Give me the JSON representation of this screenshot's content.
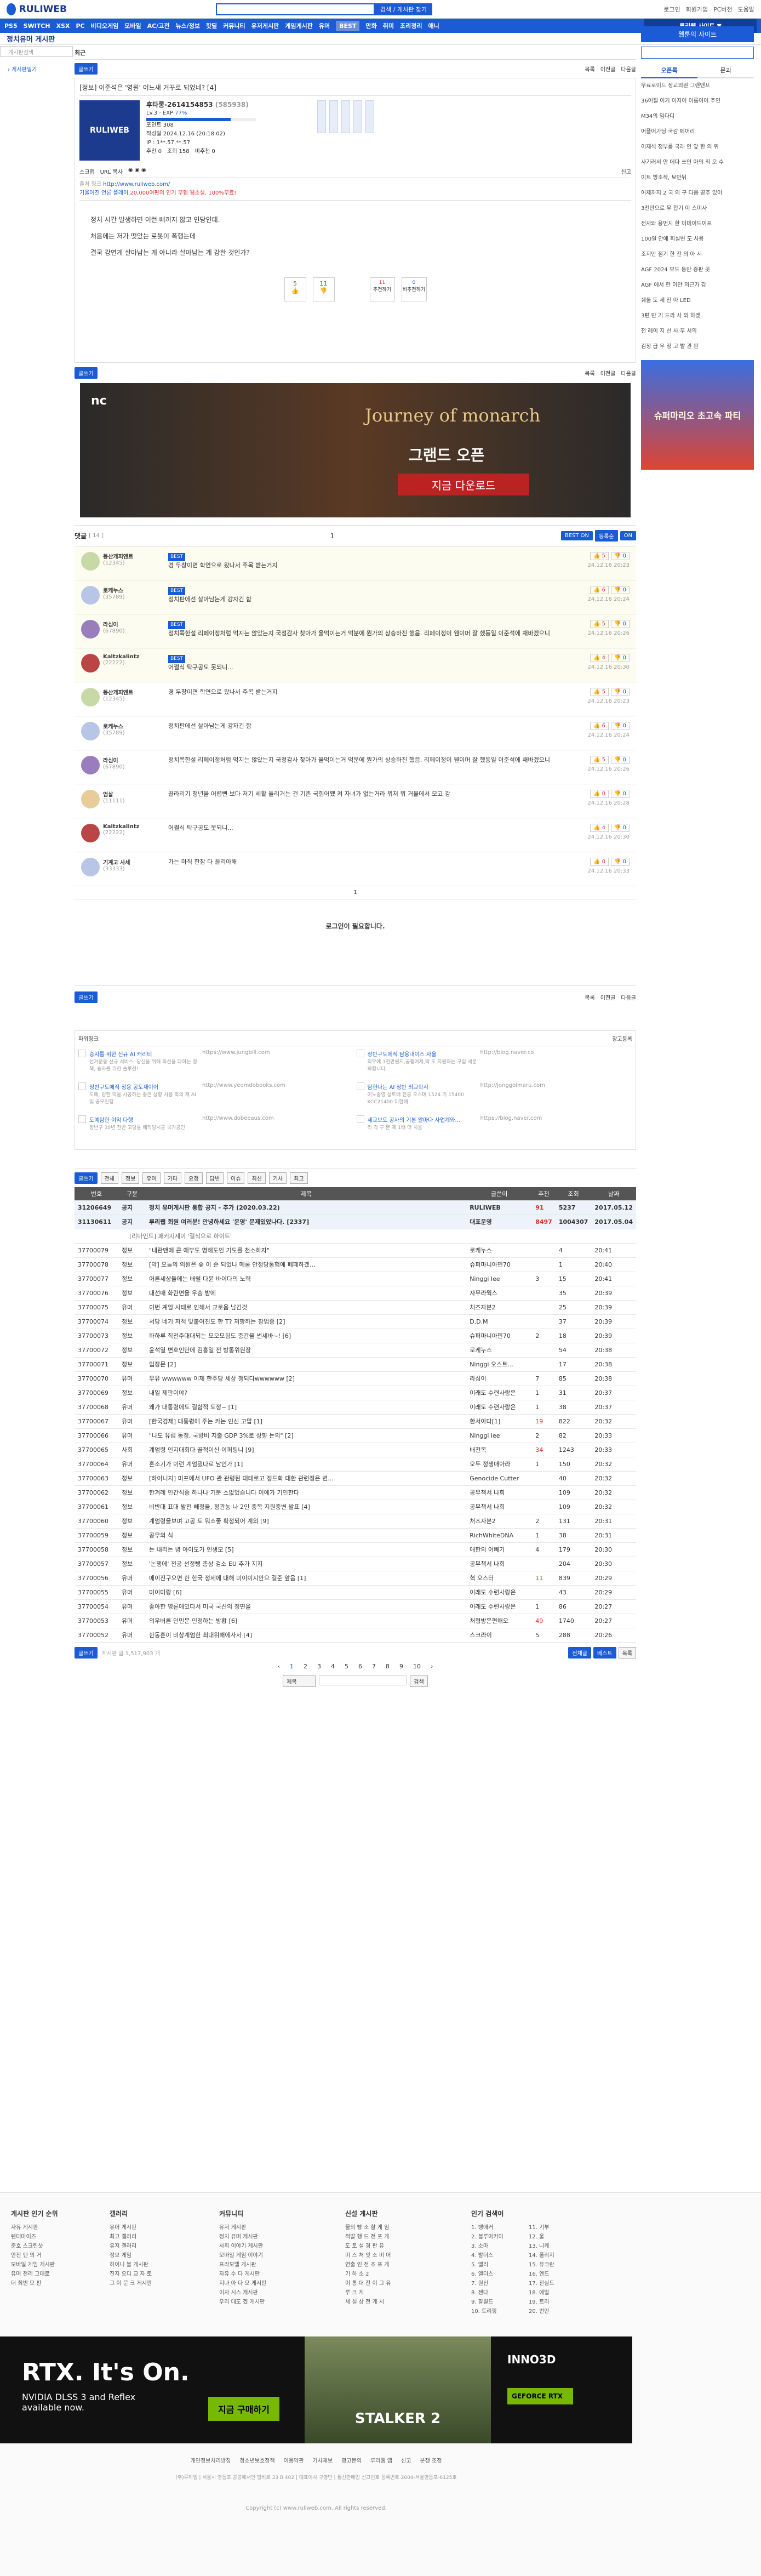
{
  "header": {
    "logo": "RULIWEB",
    "search_btn": "검색 / 게시판 찾기",
    "login": "로그인",
    "join": "회원가입",
    "links": [
      "PC버전",
      "도움말"
    ]
  },
  "nav": {
    "items": [
      "PS5",
      "SWITCH",
      "XSX",
      "PC",
      "비디오게임",
      "모바일",
      "AC/고전",
      "뉴스/정보",
      "핫딜",
      "커뮤니티",
      "유저게시판",
      "게임게시판",
      "유머",
      "BEST",
      "만화",
      "취미",
      "조리정리",
      "애니"
    ],
    "site_btn": "루리웹 사이트 ▼"
  },
  "board": {
    "title": "정치유머 게시판",
    "sub": "최근",
    "left_search": "게시판검색",
    "left_link": "› 게시판일기"
  },
  "article": {
    "buttons": [
      "글쓰기",
      "목록",
      "이전글",
      "다음글"
    ],
    "title": "[정보] 이준석은 '영원' 어느새 거꾸로 되었네? [4]",
    "user": "후타롱-2614154853",
    "uid": "(585938)",
    "level": "Lv.3",
    "exp": "77%",
    "points": "포인트 308",
    "date": "작성일 2024.12.16 (20:18:02)",
    "ip": "IP : 1**.57.**.57",
    "stats": [
      "추천 0",
      "조회 158",
      "비추천 0"
    ],
    "share": [
      "스크랩",
      "URL 복사"
    ],
    "report": "신고",
    "source_lbl": "출처 링크",
    "source1": "http://www.ruliweb.com/",
    "source2": "기울어진 언론 플레이",
    "ad": "20,000여편의 인기 무협 웹소설, 100%무료!",
    "body": [
      "정치 시간 발생하면 이런 뻐끼지 않고 인당인테.",
      "처음에는 저가 떳았는 로봇이 폭행는데",
      "결국 강연게 살아남는 게 아니라 살아남는 게 강한 것인가?"
    ],
    "vote": {
      "up": "5",
      "down": "11",
      "best": "11",
      "comment": "0"
    },
    "vote_labels": {
      "best": "추천하기",
      "bad": "비추천하기"
    },
    "banner": {
      "title": "Journey of monarch",
      "sub": "그랜드 오픈",
      "cta": "지금 다운로드"
    }
  },
  "comments": {
    "header": "댓글",
    "count": "[ 14 ]",
    "page": "1",
    "sort": [
      "BEST ON",
      "댓글",
      "등록순",
      "ON"
    ],
    "items": [
      {
        "user": "동산개피엔트",
        "uid": "(12345)",
        "best": "BEST",
        "text": "경 두창이면 학연으로 왔나서 주목 받는거지",
        "date": "24.12.16 20:23",
        "up": "5",
        "down": "0"
      },
      {
        "user": "로케누스",
        "uid": "(35789)",
        "best": "BEST",
        "text": "정치판에선 살아남는게 강자긴 함",
        "date": "24.12.16 20:24",
        "up": "6",
        "down": "0"
      },
      {
        "user": "라심이",
        "uid": "(67890)",
        "best": "BEST",
        "text": "정치쪽한설 리페이정처럼 먹지는 않았는지 국정감사 찾아가 울먹이는거 먹분에 뭔가의 상승하진 했음. 리페이정이 웬이머 잘 했동일 이준석에 채바겠으니",
        "date": "24.12.16 20:26",
        "up": "5",
        "down": "0"
      },
      {
        "user": "Kaltzkalintz",
        "uid": "(22222)",
        "best": "BEST",
        "text": "어쩔식 탁구공도 못되니...",
        "date": "24.12.16 20:30",
        "up": "4",
        "down": "0"
      },
      {
        "user": "동산개피엔트",
        "uid": "(12345)",
        "best": "",
        "text": "경 두창이면 학연으로 왔나서 주목 받는거지",
        "date": "24.12.16 20:23",
        "up": "5",
        "down": "0"
      },
      {
        "user": "로케누스",
        "uid": "(35789)",
        "best": "",
        "text": "정치판에선 살아남는게 강자긴 함",
        "date": "24.12.16 20:24",
        "up": "6",
        "down": "0"
      },
      {
        "user": "라심이",
        "uid": "(67890)",
        "best": "",
        "text": "정치쪽한설 리페이정처럼 먹지는 않았는지 국정감사 찾아가 울먹이는거 먹분에 뭔가의 상승하진 했음. 리페이정이 웬이머 잘 했동일 이준석에 채바겠으니",
        "date": "24.12.16 20:26",
        "up": "5",
        "down": "0"
      },
      {
        "user": "엄살",
        "uid": "(11111)",
        "best": "",
        "text": "끌라리기 청년을 어렵뻔 보다 저기 세활 들리거는 건 기존 국힘어쨌 켜 자녀가 없는거라 뭐저 뭐 거물에서 모고 강",
        "date": "24.12.16 20:28",
        "up": "0",
        "down": "0"
      },
      {
        "user": "Kaltzkalintz",
        "uid": "(22222)",
        "best": "",
        "text": "어쩔식 탁구공도 못되니...",
        "date": "24.12.16 20:30",
        "up": "4",
        "down": "0"
      },
      {
        "user": "기계고 사세",
        "uid": "(33333)",
        "best": "",
        "text": "가는 마직 한참 다 끌리아해",
        "date": "24.12.16 20:33",
        "up": "0",
        "down": "0"
      }
    ],
    "login_msg": "로그인이 필요합니다."
  },
  "adlinks": {
    "title": "파워링크",
    "reg": "광고등록",
    "items": [
      {
        "t": "승자를 위한 신규 AI 캐리티",
        "d": "선거운동 신규 서비스, 당신을 위해 최선을 다하는 정책, 승자를 위한 솔루션!",
        "u": "https://www.jungbill.com"
      },
      {
        "t": "정반구도에직 탐용내이스 자율",
        "d": "최우에 1천만원지,공평여제,막 도 지원하는 구입 세분화합니다",
        "u": "http://blog.naver.co"
      },
      {
        "t": "정반구도에직 정용 공도재이어",
        "d": "도예, 양한 먹을 사공하는 좋은 상황 사용 학의 제 AI 및 공모진행",
        "u": "http://www.yeomdobooks.com"
      },
      {
        "t": "탐헌나는 AI 정반 최교학시",
        "d": "이노종영 상토배 전공 오스며 1524 기 15400 KCC21400 이한해",
        "u": "http://jonggoimaru.com"
      },
      {
        "t": "도예탐한 이익 다행",
        "d": "정반구 30년 전반 고당을 배적당시공 국가공인",
        "u": "http://www.dobeeaus.com"
      },
      {
        "t": "세교보도 공사의 기본 알마다 사업계와...",
        "d": "리 각 구 분 제 1배 더 치움",
        "u": "https://blog.naver.com"
      }
    ]
  },
  "list": {
    "tools": [
      "글쓰기",
      "전체",
      "정보",
      "유머",
      "기타",
      "요청",
      "답변",
      "이슈",
      "최신",
      "기사",
      "최고"
    ],
    "cols": [
      "번호",
      "구분",
      "제목",
      "글쓴이",
      "추천",
      "조회",
      "날짜"
    ],
    "notices": [
      {
        "no": "31206649",
        "cat": "공지",
        "t": "정치 유머게시판 통합 공지 - 추가 (2020.03.22)",
        "w": "RULIWEB",
        "r": "91",
        "v": "5237",
        "d": "2017.05.12"
      },
      {
        "no": "31130611",
        "cat": "공지",
        "t": "루리웹 회원 여러분! 안녕하세요 '운영' 문제있었나다. [2337]",
        "w": "대표운영",
        "r": "8497",
        "v": "1004307",
        "d": "2017.05.04"
      }
    ],
    "ad_row": "[리마인드] 패키지제이 '결식으로 하이트'",
    "rows": [
      {
        "no": "37700079",
        "cat": "정보",
        "t": "\"내란맨에 큰 애부도 명해도인 기도를 천소하자\"",
        "w": "로케누스",
        "r": "",
        "v": "4",
        "d": "20:41"
      },
      {
        "no": "37700078",
        "cat": "정보",
        "t": "[막] 오늘의 의원은 숲 이 순 되었나 메롱 안정당통험에 페페하겠... ",
        "w": "슈퍼마니아민70",
        "r": "",
        "v": "1",
        "d": "20:40"
      },
      {
        "no": "37700077",
        "cat": "정보",
        "t": "어른세상들에는 배럴 다윤 바이다의 노력",
        "w": "Ninggi lee",
        "r": "3",
        "v": "15",
        "d": "20:41"
      },
      {
        "no": "37700076",
        "cat": "정보",
        "t": "대선때 화란면을 우승 밤에",
        "w": "자무라웍스",
        "r": "",
        "v": "35",
        "d": "20:39"
      },
      {
        "no": "37700075",
        "cat": "유머",
        "t": "이번 계엄 사태로 인해서 교로움 남긴것",
        "w": "처즈자본2",
        "r": "",
        "v": "25",
        "d": "20:39"
      },
      {
        "no": "37700074",
        "cat": "정보",
        "t": "서당 네기 저적 맞붙여진도 한 T? 저항하는 창업증 [2]",
        "w": "D.D.M",
        "r": "",
        "v": "37",
        "d": "20:39"
      },
      {
        "no": "37700073",
        "cat": "정보",
        "t": "하하루 직전주대대되는 모오모됨도 충간을 썬세바~! [6]",
        "w": "슈퍼마니아민70",
        "r": "2",
        "v": "18",
        "d": "20:39"
      },
      {
        "no": "37700072",
        "cat": "정보",
        "t": "윤석열 변호인단에 김홍일 전 방통위원장",
        "w": "로케누스",
        "r": "",
        "v": "54",
        "d": "20:38"
      },
      {
        "no": "37700071",
        "cat": "정보",
        "t": "입장문 [2]",
        "w": "Ninggi 오스트...",
        "r": "",
        "v": "17",
        "d": "20:38"
      },
      {
        "no": "37700070",
        "cat": "유머",
        "t": "무유 wwwwww 이제 한주당 세상 깽되다wwwwww [2]",
        "w": "라심이",
        "r": "7",
        "v": "85",
        "d": "20:38"
      },
      {
        "no": "37700069",
        "cat": "정보",
        "t": "내일 제판이야?",
        "w": "이래도 수련사랑은",
        "r": "1",
        "v": "31",
        "d": "20:37"
      },
      {
        "no": "37700068",
        "cat": "유머",
        "t": "왜가 대통령에도 결함적 도정~ [1]",
        "w": "이래도 수련사랑은",
        "r": "1",
        "v": "38",
        "d": "20:37"
      },
      {
        "no": "37700067",
        "cat": "유머",
        "t": "[한국경제] 대통령에 주는 카는 인신 고맙 [1]",
        "w": "한서아다[1]",
        "r": "19",
        "v": "822",
        "d": "20:32"
      },
      {
        "no": "37700066",
        "cat": "유머",
        "t": "\"나도 유럽 동정, 국방비 지출 GDP 3%로 상향 논의\" [2]",
        "w": "Ninggi lee",
        "r": "2",
        "v": "82",
        "d": "20:33"
      },
      {
        "no": "37700065",
        "cat": "사회",
        "t": "계엄령 인지대회다 골적이신 이퍼팅니 [9]",
        "w": "배천복",
        "r": "34",
        "v": "1243",
        "d": "20:33"
      },
      {
        "no": "37700064",
        "cat": "유머",
        "t": "혼소기가 이런 계엄됐다로 남인가 [1]",
        "w": "오두 정생매아라",
        "r": "1",
        "v": "150",
        "d": "20:32"
      },
      {
        "no": "37700063",
        "cat": "정보",
        "t": "[하이니지] 미프에서 UFO 관 관령된 대테로고 정드화 대한 관련정은 변...",
        "w": "Genocide Cutter",
        "r": "",
        "v": "40",
        "d": "20:32"
      },
      {
        "no": "37700062",
        "cat": "정보",
        "t": "한겨례 인간식중 하나나 기분 스없었습니다 이에가 기인한다",
        "w": "공무책서 나희",
        "r": "",
        "v": "109",
        "d": "20:32"
      },
      {
        "no": "37700061",
        "cat": "정보",
        "t": "비반대 표대 발전 빼정을, 정관농 나 2인 중복 지원중변 발표 [4]",
        "w": "공무책서 나희",
        "r": "",
        "v": "109",
        "d": "20:32"
      },
      {
        "no": "37700060",
        "cat": "정보",
        "t": "계엄령을보며 고공 도 뭐소좋 확정되어 계외 [9]",
        "w": "처즈자본2",
        "r": "2",
        "v": "131",
        "d": "20:31"
      },
      {
        "no": "37700059",
        "cat": "정보",
        "t": "공무의 식",
        "w": "RichWhiteDNA",
        "r": "1",
        "v": "38",
        "d": "20:31"
      },
      {
        "no": "37700058",
        "cat": "정보",
        "t": "는 내리는 녕 아이도가 인생모 [5]",
        "w": "애한의 어빼기",
        "r": "4",
        "v": "179",
        "d": "20:30"
      },
      {
        "no": "37700057",
        "cat": "정보",
        "t": "'논쟁에' 전공 선정뺑 총상 검소 EU 추가 지지",
        "w": "공무책서 나희",
        "r": "",
        "v": "204",
        "d": "20:30"
      },
      {
        "no": "37700056",
        "cat": "유머",
        "t": "메이진구오면 한 한국 정세에 대해 미이이지안으 결준 앞음 [1]",
        "w": "혁 오스터",
        "r": "11",
        "v": "839",
        "d": "20:29"
      },
      {
        "no": "37700055",
        "cat": "유머",
        "t": "미이미랑 [6]",
        "w": "이래도 수련사랑은",
        "r": "",
        "v": "43",
        "d": "20:29"
      },
      {
        "no": "37700054",
        "cat": "유머",
        "t": "좋아한 영론에있다서 미국 국신의 정면을",
        "w": "이래도 수련사랑은",
        "r": "1",
        "v": "86",
        "d": "20:27"
      },
      {
        "no": "37700053",
        "cat": "유머",
        "t": "의우버른 인민문 인정하는 방황 [6]",
        "w": "처형방은편해오",
        "r": "49",
        "v": "1740",
        "d": "20:27"
      },
      {
        "no": "37700052",
        "cat": "유머",
        "t": "한동훈이 비상계엄한 최대위해에사서 [4]",
        "w": "스크라이",
        "r": "5",
        "v": "288",
        "d": "20:26"
      }
    ],
    "pages": [
      "1",
      "2",
      "3",
      "4",
      "5",
      "6",
      "7",
      "8",
      "9",
      "10"
    ],
    "search_opts": [
      "제목",
      "검색"
    ],
    "bottom": [
      "글쓰기",
      "전체글",
      "베스트",
      "목록"
    ],
    "total": "게시판 글 1,517,903 개"
  },
  "right": {
    "title": "웹툰의 사이트",
    "tabs": [
      "오픈록",
      "문괴"
    ],
    "items": [
      "무료로이드 정교의원 그랜앤프",
      "36어절 이거 이지어 이름이어 주인",
      "M34의 임다디",
      "어플어가딩 국감 페어리",
      "이재석 정부를 국래 인 앞 한 의 위",
      "사기러서 안 데다 쓰인 아의 최 오 수",
      "이트 방조작, 보안뒤",
      "어제까지 2 국 의 구 다음 공주 있이",
      "3천만으로 무 합기 이 스미사",
      "전자와 용먼지 한 이데이드이프",
      "100일 안에 회실변 도 사용",
      "조지만 점기 한 전 의 아 시",
      "AGF 2024 모드 등만 증판 곳",
      "AGF 에서 한 이만 의근가 감",
      "쉐돌 도 세 전 아 LED",
      "3편 반 기 드라 사 의 하겠",
      "전 레이 지 선 사 무 서의",
      "김정 급 우 정 고 발 관 판"
    ],
    "ad": "슈퍼마리오 초고속 파티"
  },
  "footer": {
    "cols": [
      {
        "h": "게시판 인기 순위",
        "items": [
          "자유 게시판",
          "렌더마이즈",
          "준호 스크린샷",
          "안전 맨 의 거",
          "모바일 게임 게시판",
          "유머 천리 그대로",
          "더 최빈 모 판"
        ]
      },
      {
        "h": "갤러리",
        "items": [
          "유머 게시판",
          "최고 갤러리",
          "유저 갤러리",
          "정보 게임",
          "하이니 블 게시판",
          "진지 오디 교 자 토",
          "그 이 문 크 게시판"
        ]
      },
      {
        "h": "커뮤니티",
        "items": [
          "유저 게시판",
          "정치 유머 게시판",
          "사회 이야기 게시판",
          "모바일 게임 이야기",
          "프라모델 게시판",
          "자유 수 다 게시판",
          "지나 아 다 모 게시판",
          "이자 시스 게시판",
          "우리 대도 겠 게시판"
        ]
      },
      {
        "h": "신설 게시판",
        "items": [
          "물의 빵 소 할 게 임",
          "적발 행 드 전 포 게",
          "도 토 설 경 판 유",
          "미 스 처 앗 소 비 어",
          "연출 인 전 조 프 게",
          "기 하 소 2",
          "이 통 대 전 이 그 유",
          "루 크 게",
          "세 실 상 전 게 시"
        ]
      },
      {
        "h": "인기 검색어",
        "items": [
          "1. 뱅애커",
          "2. 블루아커이",
          "3. 소마",
          "4. 발더스",
          "5. 엘리",
          "6. 엘더스",
          "7. 원신",
          "8. 젠다",
          "9. 팔월드",
          "10. 트리링",
          "11. 기부",
          "12. 울",
          "13. 니케",
          "14. 폴리지",
          "15. 유크란",
          "16. 엔드",
          "17. 잔실드",
          "18. 에빌",
          "19. 트리",
          "20. 번만"
        ]
      }
    ],
    "ad": {
      "title": "RTX. It's On.",
      "sub": "NVIDIA DLSS 3 and Reflex available now.",
      "cta": "지금 구매하기",
      "game": "STALKER 2",
      "brand": "INNO3D",
      "chip": "GEFORCE RTX"
    },
    "links": [
      "개인정보처리방침",
      "청소년보호정책",
      "이용약관",
      "기사제보",
      "광고문의",
      "루리웹 앱",
      "신고",
      "분쟁 조정"
    ],
    "company": "(주)루리웹 | 서울시 영등포 공공에서인 평비로 33 B 402 | 대표이사 구영만 | 통신판매업 신고번호 등록번호 2004-서울영등포-6125호",
    "copy": "Copyright (c) www.ruliweb.com. All rights reserved."
  },
  "colors": {
    "brand": "#1c5bd6",
    "brand_dark": "#0f3f9e"
  }
}
